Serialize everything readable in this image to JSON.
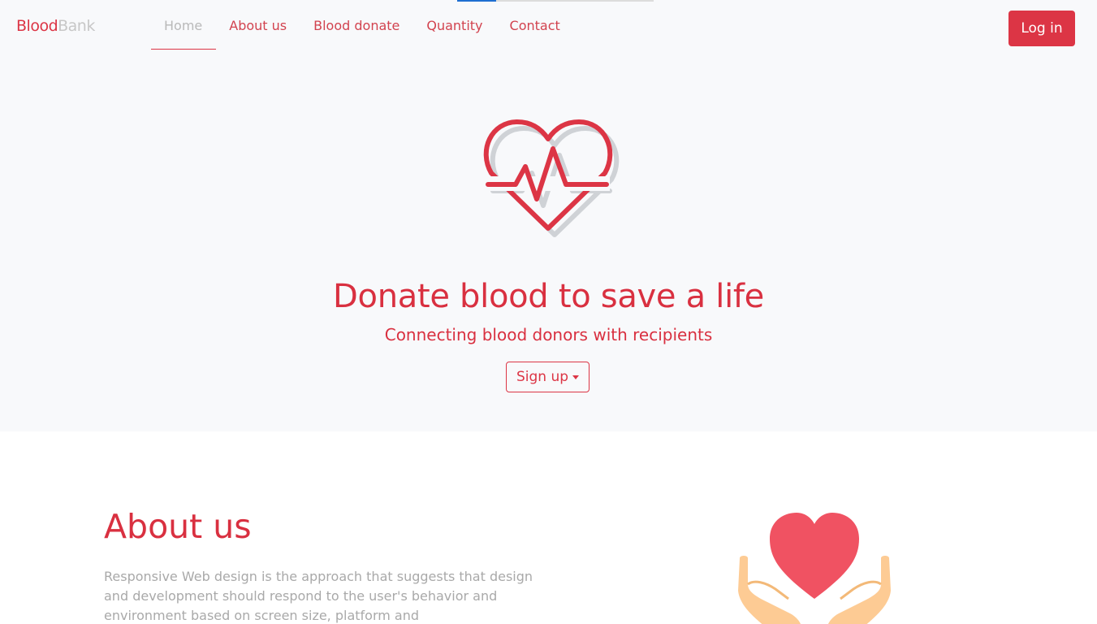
{
  "brand": {
    "part1": "Blood",
    "part2": "Bank"
  },
  "nav": {
    "items": [
      {
        "label": "Home",
        "active": true
      },
      {
        "label": "About us",
        "active": false
      },
      {
        "label": "Blood donate",
        "active": false
      },
      {
        "label": "Quantity",
        "active": false
      },
      {
        "label": "Contact",
        "active": false
      }
    ],
    "login_label": "Log in"
  },
  "hero": {
    "icon": "heartbeat-heart-icon",
    "title": "Donate blood to save a life",
    "subtitle": "Connecting blood donors with recipients",
    "signup_label": "Sign up"
  },
  "about": {
    "title": "About us",
    "text": "Responsive Web design is the approach that suggests that design and development should respond to the user's behavior and environment based on screen size, platform and",
    "illustration": "hands-holding-heart-icon"
  },
  "colors": {
    "accent": "#dc3545",
    "hero_bg": "#f8f9fb",
    "muted_text": "#a9a9a9",
    "illustration_heart": "#f05262",
    "illustration_hands": "#fdcb94"
  }
}
